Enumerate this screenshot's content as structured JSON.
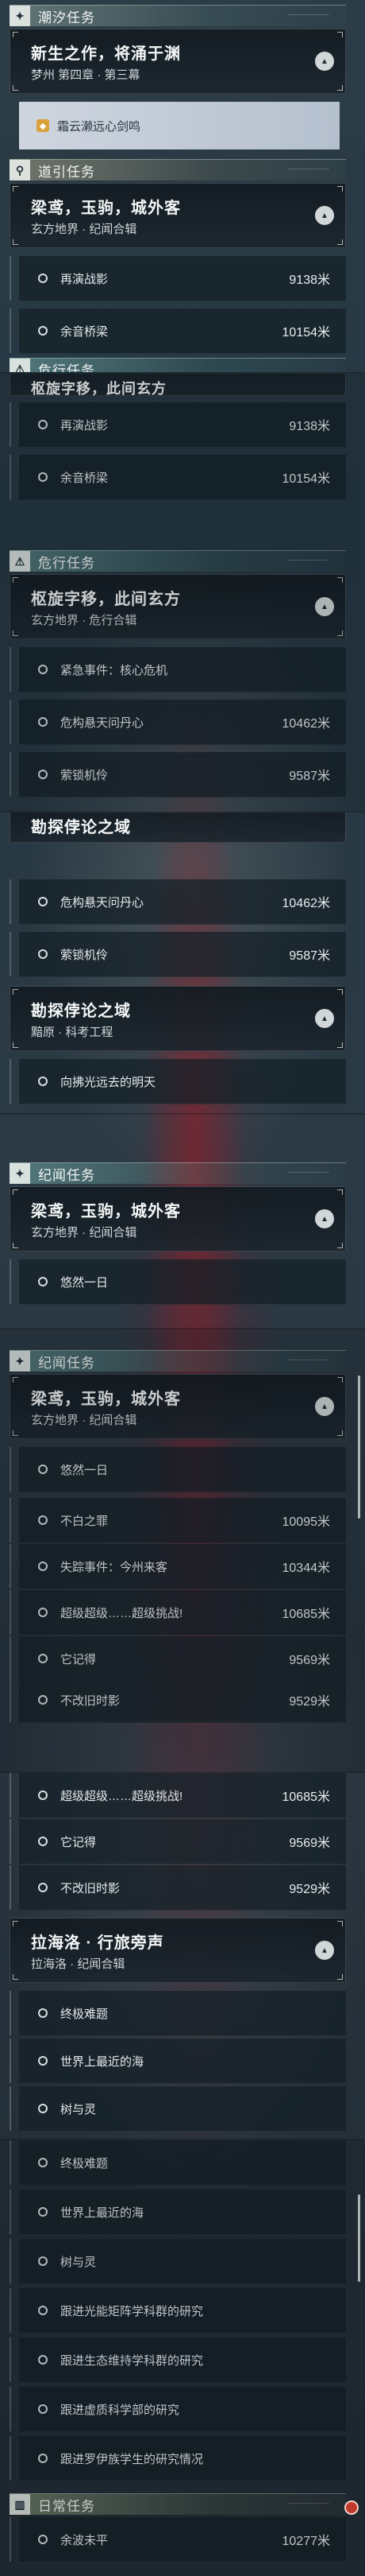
{
  "sections": {
    "tides": {
      "title": "潮汐任务",
      "icon": "plus-star-icon"
    },
    "guide": {
      "title": "道引任务",
      "icon": "location-pin-icon"
    },
    "danger": {
      "title": "危行任务",
      "icon": "danger-icon"
    },
    "chronicle": {
      "title": "纪闻任务",
      "icon": "plus-star-icon"
    },
    "daily": {
      "title": "日常任务",
      "icon": "book-icon"
    }
  },
  "quests": {
    "tides_main": {
      "title": "新生之作，将涌于渊",
      "subtitle": "梦州 第四章 · 第三幕"
    },
    "tides_hint": "霜云濑远心剑鸣",
    "guide_main": {
      "title": "梁鸢，玉驹，城外客",
      "subtitle": "玄方地界 · 纪闻合辑"
    },
    "danger_main": {
      "title": "枢旋字移，此间玄方",
      "subtitle": "玄方地界 · 危行合辑"
    },
    "danger_partial": "枢旋字移，此间玄方",
    "survey": {
      "title": "勘探侼论之域",
      "subtitle": "黯原 · 科考工程"
    },
    "chron_a": {
      "title": "梁鸢，玉驹，城外客",
      "subtitle": "玄方地界 · 纪闻合辑"
    },
    "chron_b": {
      "title": "梁鸢，玉驹，城外客",
      "subtitle": "玄方地界 · 纪闻合辑"
    },
    "rahaylo": {
      "title": "拉海洛 · 行旅旁声",
      "subtitle": "拉海洛 · 纪闻合辑"
    }
  },
  "rows": {
    "replay": "再演战影",
    "replay_dist": "9138米",
    "bridge": "余音桥梁",
    "bridge_dist": "10154米",
    "emergency": "紧急事件：核心危机",
    "danger_sky": "危构悬天问丹心",
    "danger_sky_dist": "10462米",
    "lock": "萦锁机伶",
    "lock_dist": "9587米",
    "tomorrow": "向拂光远去的明天",
    "leisure": "悠然一日",
    "unforgiven": "不白之罪",
    "unforgiven_dist": "10095米",
    "missing": "失踪事件：今州来客",
    "missing_dist": "10344米",
    "challenge": "超级超级……超级挑战!",
    "challenge_dist": "10685米",
    "remember": "它记得",
    "remember_dist": "9569米",
    "shadow": "不改旧时影",
    "shadow_dist": "9529米",
    "finale": "终极难题",
    "sea": "世界上最近的海",
    "tree": "树与灵",
    "research1": "跟进光能矩阵学科群的研究",
    "research2": "跟进生态维持学科群的研究",
    "research3": "跟进虚质科学部的研究",
    "research4": "跟进罗伊族学生的研究情况",
    "calm": "余波未平",
    "calm_dist": "10277米"
  },
  "colors": {
    "tides": "#d9e6de",
    "guide": "#e6dcb0",
    "danger": "#9fe0d4",
    "chronicle": "#a8d8e0",
    "daily": "#cfe2a8"
  }
}
